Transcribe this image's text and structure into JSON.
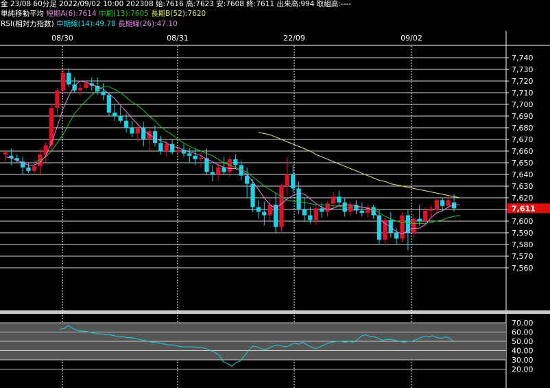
{
  "header": {
    "line1": "金 23/08 60分足 2022/09/02 10:00 202308 始:7616 高:7623 安:7608 終:7611 出来高:994 取組高:----",
    "ma_title": "単純移動平均",
    "ma_short": "短期A(6):7614",
    "ma_mid": "中期(13):7605",
    "ma_long": "長期B(52):7620",
    "rsi_title": "RSI(相対力指数)",
    "rsi_mid": "中期線(14):49.78",
    "rsi_long": "長期線(26):47.10"
  },
  "colors": {
    "up": "#e0102a",
    "down": "#19d3e6",
    "ma_short": "#e088e0",
    "ma_mid": "#22c022",
    "ma_long": "#e8e870",
    "rsi_mid": "#19d3e6",
    "rsi_long": "#e088e0",
    "last_price_bg": "#e01010"
  },
  "chart_data": [
    {
      "type": "candlestick",
      "x_labels": [
        "08/30",
        "08/31",
        "22/09",
        "09/02"
      ],
      "ylim": [
        7560,
        7745
      ],
      "y_ticks": [
        "7,740",
        "7,730",
        "7,720",
        "7,710",
        "7,700",
        "7,690",
        "7,680",
        "7,670",
        "7,660",
        "7,650",
        "7,640",
        "7,630",
        "7,620",
        "7,610",
        "7,600",
        "7,590",
        "7,580",
        "7,570",
        "7,560"
      ],
      "last_price_label": "7,611",
      "last_price": 7611,
      "candles": [
        [
          7657,
          7661,
          7651,
          7659
        ],
        [
          7656,
          7662,
          7648,
          7654
        ],
        [
          7654,
          7657,
          7650,
          7652
        ],
        [
          7651,
          7655,
          7640,
          7646
        ],
        [
          7646,
          7650,
          7641,
          7643
        ],
        [
          7643,
          7651,
          7641,
          7647
        ],
        [
          7647,
          7662,
          7640,
          7657
        ],
        [
          7657,
          7668,
          7650,
          7665
        ],
        [
          7665,
          7700,
          7660,
          7697
        ],
        [
          7697,
          7714,
          7692,
          7712
        ],
        [
          7712,
          7731,
          7708,
          7727
        ],
        [
          7727,
          7731,
          7715,
          7717
        ],
        [
          7717,
          7723,
          7710,
          7712
        ],
        [
          7712,
          7718,
          7708,
          7714
        ],
        [
          7714,
          7720,
          7710,
          7718
        ],
        [
          7718,
          7723,
          7712,
          7716
        ],
        [
          7716,
          7723,
          7708,
          7711
        ],
        [
          7711,
          7718,
          7704,
          7708
        ],
        [
          7708,
          7710,
          7690,
          7693
        ],
        [
          7693,
          7700,
          7686,
          7690
        ],
        [
          7690,
          7698,
          7684,
          7686
        ],
        [
          7686,
          7692,
          7676,
          7680
        ],
        [
          7680,
          7686,
          7672,
          7675
        ],
        [
          7675,
          7683,
          7668,
          7680
        ],
        [
          7680,
          7685,
          7664,
          7670
        ],
        [
          7670,
          7679,
          7660,
          7677
        ],
        [
          7677,
          7682,
          7664,
          7667
        ],
        [
          7667,
          7673,
          7657,
          7660
        ],
        [
          7660,
          7670,
          7655,
          7666
        ],
        [
          7666,
          7670,
          7657,
          7659
        ],
        [
          7659,
          7664,
          7654,
          7661
        ],
        [
          7661,
          7666,
          7655,
          7658
        ],
        [
          7658,
          7663,
          7650,
          7656
        ],
        [
          7656,
          7662,
          7648,
          7653
        ],
        [
          7653,
          7659,
          7646,
          7654
        ],
        [
          7654,
          7662,
          7640,
          7642
        ],
        [
          7642,
          7648,
          7634,
          7640
        ],
        [
          7640,
          7650,
          7636,
          7646
        ],
        [
          7646,
          7655,
          7640,
          7642
        ],
        [
          7642,
          7656,
          7638,
          7653
        ],
        [
          7653,
          7657,
          7645,
          7648
        ],
        [
          7648,
          7652,
          7635,
          7639
        ],
        [
          7639,
          7646,
          7620,
          7632
        ],
        [
          7632,
          7636,
          7608,
          7612
        ],
        [
          7612,
          7618,
          7602,
          7608
        ],
        [
          7608,
          7617,
          7596,
          7605
        ],
        [
          7605,
          7620,
          7600,
          7614
        ],
        [
          7614,
          7624,
          7590,
          7595
        ],
        [
          7595,
          7632,
          7590,
          7630
        ],
        [
          7630,
          7655,
          7622,
          7640
        ],
        [
          7640,
          7648,
          7625,
          7628
        ],
        [
          7628,
          7634,
          7606,
          7610
        ],
        [
          7610,
          7620,
          7600,
          7605
        ],
        [
          7605,
          7612,
          7598,
          7601
        ],
        [
          7601,
          7614,
          7597,
          7611
        ],
        [
          7611,
          7616,
          7603,
          7608
        ],
        [
          7608,
          7617,
          7604,
          7615
        ],
        [
          7615,
          7625,
          7611,
          7621
        ],
        [
          7621,
          7626,
          7612,
          7616
        ],
        [
          7616,
          7620,
          7604,
          7608
        ],
        [
          7608,
          7617,
          7604,
          7614
        ],
        [
          7614,
          7618,
          7606,
          7609
        ],
        [
          7609,
          7616,
          7604,
          7607
        ],
        [
          7607,
          7614,
          7603,
          7612
        ],
        [
          7612,
          7614,
          7602,
          7605
        ],
        [
          7605,
          7610,
          7580,
          7584
        ],
        [
          7584,
          7603,
          7580,
          7601
        ],
        [
          7601,
          7608,
          7586,
          7590
        ],
        [
          7590,
          7594,
          7580,
          7585
        ],
        [
          7585,
          7608,
          7582,
          7605
        ],
        [
          7605,
          7610,
          7575,
          7590
        ],
        [
          7590,
          7606,
          7586,
          7602
        ],
        [
          7602,
          7614,
          7596,
          7600
        ],
        [
          7600,
          7612,
          7596,
          7609
        ],
        [
          7609,
          7613,
          7603,
          7610
        ],
        [
          7610,
          7620,
          7607,
          7618
        ],
        [
          7618,
          7620,
          7608,
          7613
        ],
        [
          7613,
          7622,
          7610,
          7618
        ],
        [
          7616,
          7623,
          7608,
          7611
        ]
      ],
      "ma_short": [
        7655,
        7654,
        7652,
        7650,
        7648,
        7648,
        7650,
        7656,
        7667,
        7681,
        7696,
        7707,
        7716,
        7720,
        7719,
        7717,
        7715,
        7713,
        7709,
        7705,
        7699,
        7694,
        7688,
        7683,
        7678,
        7674,
        7671,
        7669,
        7667,
        7664,
        7663,
        7661,
        7659,
        7658,
        7656,
        7653,
        7651,
        7648,
        7646,
        7645,
        7645,
        7643,
        7640,
        7634,
        7627,
        7620,
        7614,
        7611,
        7615,
        7619,
        7622,
        7624,
        7623,
        7619,
        7615,
        7612,
        7610,
        7611,
        7613,
        7614,
        7614,
        7613,
        7612,
        7611,
        7609,
        7602,
        7598,
        7595,
        7591,
        7589,
        7592,
        7594,
        7594,
        7597,
        7603,
        7607,
        7609,
        7612,
        7614,
        7614
      ],
      "ma_mid": [
        null,
        null,
        null,
        null,
        null,
        7651,
        7652,
        7655,
        7660,
        7667,
        7674,
        7683,
        7692,
        7698,
        7703,
        7708,
        7712,
        7715,
        7715,
        7713,
        7710,
        7706,
        7702,
        7699,
        7695,
        7690,
        7686,
        7681,
        7677,
        7674,
        7670,
        7667,
        7664,
        7662,
        7660,
        7658,
        7656,
        7653,
        7650,
        7648,
        7646,
        7644,
        7642,
        7638,
        7634,
        7630,
        7627,
        7624,
        7621,
        7618,
        7617,
        7617,
        7616,
        7615,
        7614,
        7614,
        7614,
        7613,
        7613,
        7612,
        7612,
        7612,
        7612,
        7611,
        7610,
        7607,
        7604,
        7602,
        7600,
        7599,
        7598,
        7598,
        7598,
        7598,
        7599,
        7600,
        7601,
        7603,
        7604,
        7605
      ],
      "ma_long": [
        null,
        null,
        null,
        null,
        null,
        null,
        null,
        null,
        null,
        null,
        null,
        null,
        null,
        null,
        null,
        null,
        null,
        null,
        null,
        null,
        null,
        null,
        null,
        null,
        null,
        null,
        null,
        null,
        null,
        null,
        null,
        null,
        null,
        null,
        null,
        null,
        null,
        null,
        null,
        null,
        null,
        null,
        null,
        null,
        7676,
        7675,
        7674,
        7672,
        7670,
        7668,
        7666,
        7664,
        7662,
        7660,
        7657,
        7655,
        7653,
        7651,
        7649,
        7647,
        7645,
        7643,
        7641,
        7639,
        7637,
        7635,
        7634,
        7632,
        7631,
        7630,
        7629,
        7628,
        7627,
        7626,
        7625,
        7624,
        7623,
        7622,
        7621,
        7620
      ]
    },
    {
      "type": "line",
      "ylim": [
        25,
        80
      ],
      "y_ticks": [
        "70.00",
        "60.00",
        "50.00",
        "40.00",
        "30.00",
        "20.00"
      ],
      "series": [
        {
          "name": "中期線(14)",
          "color_key": "rsi_mid",
          "values": [
            null,
            null,
            null,
            null,
            null,
            null,
            null,
            null,
            null,
            null,
            null,
            null,
            null,
            63,
            64,
            67,
            64,
            62,
            61,
            61,
            60,
            59,
            58,
            58,
            57,
            57,
            56,
            55,
            55,
            54,
            54,
            53,
            52,
            51,
            50,
            49,
            49,
            48,
            47,
            46,
            46,
            45,
            44,
            44,
            44,
            44,
            43,
            43,
            42,
            40,
            38,
            35,
            28,
            26,
            23,
            27,
            29,
            34,
            40,
            45,
            44,
            42,
            41,
            43,
            45,
            46,
            45,
            44,
            46,
            48,
            47,
            49,
            46,
            44,
            42,
            44,
            46,
            48,
            49,
            50,
            50,
            49,
            50,
            49,
            52,
            56,
            57,
            55,
            55,
            53,
            51,
            52,
            52,
            51,
            50,
            49,
            50,
            50,
            52,
            54,
            55,
            55,
            56,
            54,
            53,
            55,
            53,
            50
          ]
        },
        {
          "name": "長期線(26)",
          "color_key": "rsi_long",
          "values": [
            null,
            null,
            null,
            null,
            null,
            null,
            null,
            null,
            null,
            null,
            null,
            null,
            null,
            null,
            null,
            null,
            null,
            null,
            null,
            null,
            null,
            null,
            null,
            null,
            null,
            null,
            null,
            null,
            null,
            null,
            null,
            null,
            null,
            null,
            null,
            null,
            null,
            null,
            null,
            null,
            null,
            null,
            null,
            null,
            null,
            null,
            null,
            null,
            null,
            null,
            null,
            null,
            null,
            null,
            null,
            null,
            null,
            null,
            null,
            null,
            null,
            null,
            null,
            null,
            null,
            null,
            null,
            null,
            null,
            null,
            null,
            null,
            null,
            null,
            null,
            null,
            null,
            null,
            null,
            null,
            null,
            null,
            null,
            null,
            null,
            null,
            null,
            null,
            null,
            null,
            null,
            null,
            null,
            null,
            null,
            null,
            null,
            null,
            null,
            null,
            null,
            null,
            null,
            null,
            null,
            null,
            null,
            null
          ]
        }
      ]
    }
  ]
}
